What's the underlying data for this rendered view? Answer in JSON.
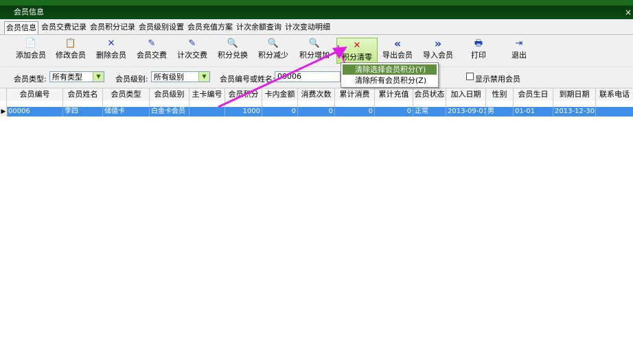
{
  "window": {
    "title": "会员信息",
    "close_glyph": "×"
  },
  "tabs": [
    {
      "label": "会员信息",
      "active": true
    },
    {
      "label": "会员交费记录"
    },
    {
      "label": "会员积分记录"
    },
    {
      "label": "会员级别设置"
    },
    {
      "label": "会员充值方案"
    },
    {
      "label": "计次余额查询"
    },
    {
      "label": "计次变动明细"
    }
  ],
  "toolbar": [
    {
      "label": "添加会员",
      "icon": "📄",
      "icon_name": "new-document-icon"
    },
    {
      "label": "修改会员",
      "icon": "📋",
      "icon_name": "edit-document-icon"
    },
    {
      "label": "删除会员",
      "icon": "✕",
      "icon_name": "delete-icon"
    },
    {
      "label": "会员交费",
      "icon": "✎",
      "icon_name": "pen-icon"
    },
    {
      "label": "计次交费",
      "icon": "✎",
      "icon_name": "pen-icon"
    },
    {
      "label": "积分兑换",
      "icon": "🔍",
      "icon_name": "magnifier-icon"
    },
    {
      "label": "积分减少",
      "icon": "🔍",
      "icon_name": "magnifier-minus-icon"
    },
    {
      "label": "积分增加",
      "icon": "🔍",
      "icon_name": "magnifier-plus-icon"
    },
    {
      "label": "积分清零",
      "icon": "✕",
      "icon_name": "clear-icon"
    },
    {
      "label": "导出会员",
      "icon": "«",
      "icon_name": "export-icon"
    },
    {
      "label": "导入会员",
      "icon": "»",
      "icon_name": "import-icon"
    },
    {
      "label": "打印",
      "icon": "🖶",
      "icon_name": "printer-icon"
    },
    {
      "label": "退出",
      "icon": "⇥",
      "icon_name": "exit-icon"
    }
  ],
  "filters": {
    "member_type_label": "会员类型:",
    "member_type_value": "所有类型",
    "member_level_label": "会员级别:",
    "member_level_value": "所有级别",
    "search_label": "会员编号或姓名:",
    "search_value": "00006",
    "show_disabled_label": "显示禁用会员"
  },
  "dropdown": {
    "items": [
      {
        "label": "清除选择会员积分(Y)",
        "selected": true
      },
      {
        "label": "清除所有会员积分(Z)",
        "selected": false
      }
    ]
  },
  "columns": [
    "会员编号",
    "会员姓名",
    "会员类型",
    "会员级别",
    "主卡编号",
    "会员积分",
    "卡内金额",
    "消费次数",
    "累计消费",
    "累计充值",
    "会员状态",
    "加入日期",
    "性别",
    "会员生日",
    "到期日期",
    "联系电话"
  ],
  "rows": [
    [
      "00006",
      "李四",
      "储值卡",
      "白金卡会员",
      "",
      "1000",
      "0",
      "0",
      "0",
      "0",
      "正常",
      "2013-09-01",
      "男",
      "01-01",
      "2013-12-30",
      ""
    ]
  ],
  "row_indicator": "▶",
  "colors": {
    "accent_green": "#8cbf4c",
    "selection_blue": "#3f8ee8",
    "annotation_arrow": "#e020e0"
  }
}
